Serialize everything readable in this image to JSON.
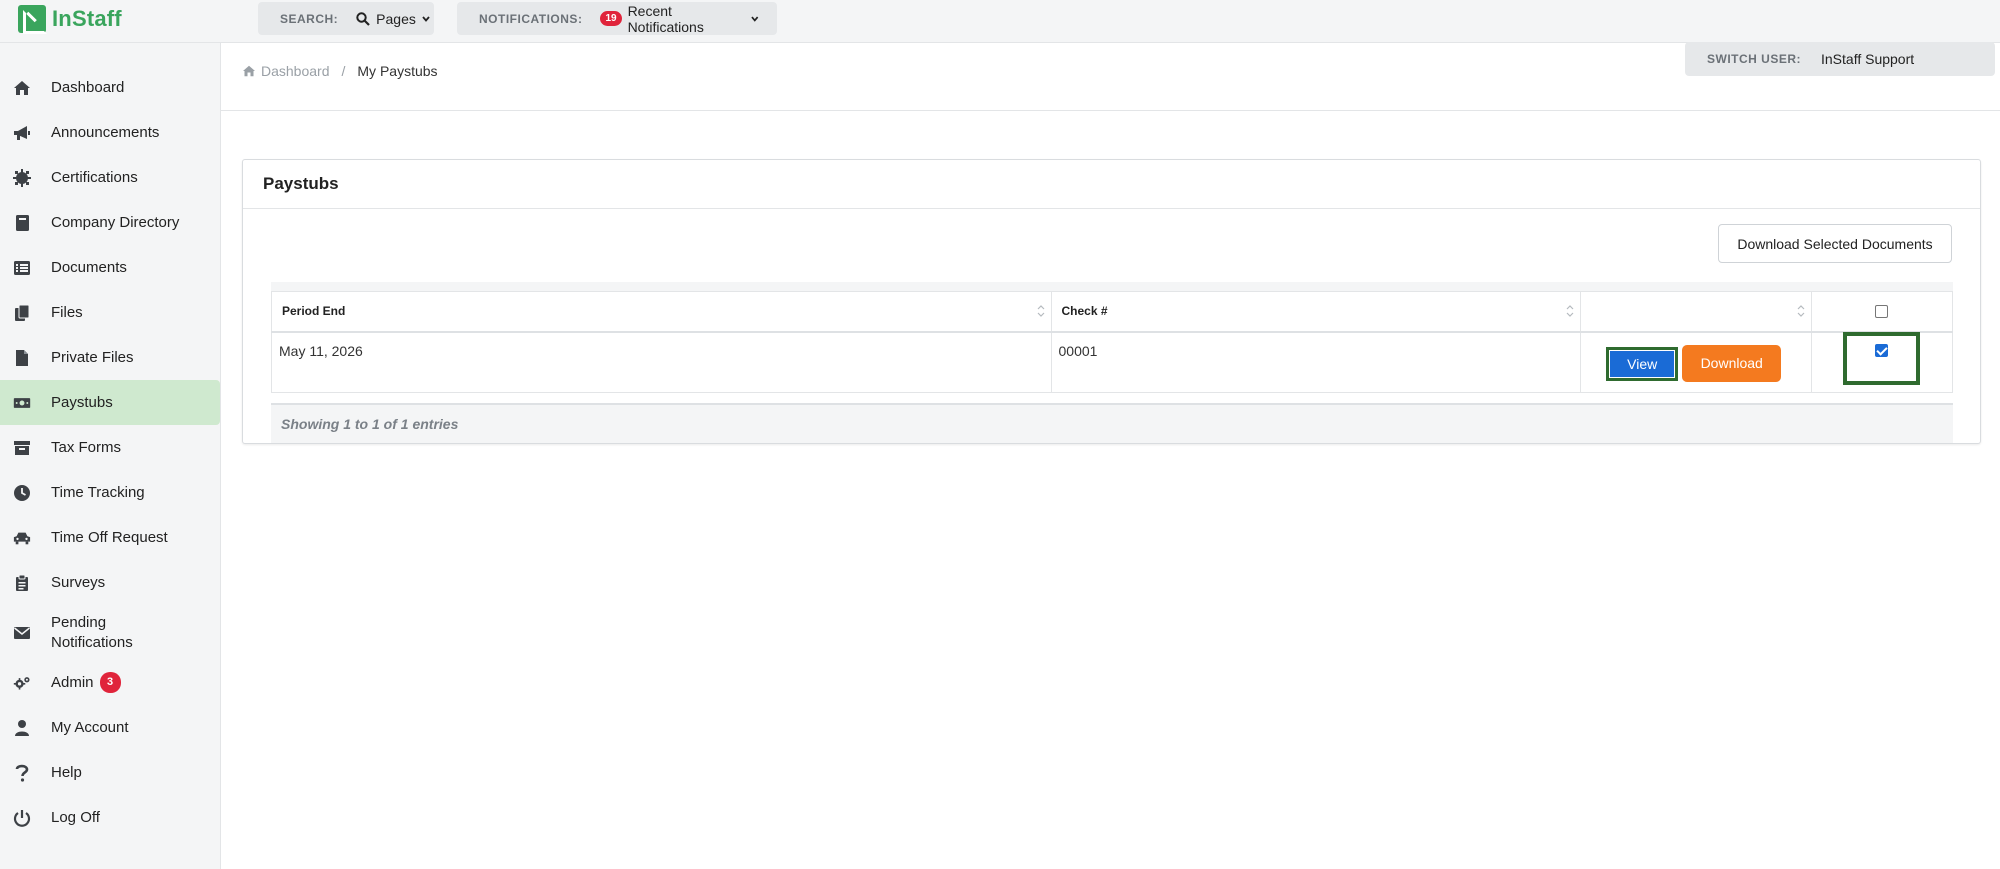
{
  "app": {
    "logo_text": "InStaff"
  },
  "topbar": {
    "search_label": "SEARCH:",
    "search_value": "Pages",
    "notifications_label": "NOTIFICATIONS:",
    "notifications_count": "19",
    "notifications_value": "Recent Notifications",
    "switch_user_label": "SWITCH USER:",
    "switch_user_value": "InStaff Support"
  },
  "sidebar": {
    "items": [
      {
        "label": "Dashboard",
        "icon": "home-icon"
      },
      {
        "label": "Announcements",
        "icon": "megaphone-icon"
      },
      {
        "label": "Certifications",
        "icon": "certificate-icon"
      },
      {
        "label": "Company Directory",
        "icon": "book-icon"
      },
      {
        "label": "Documents",
        "icon": "list-icon"
      },
      {
        "label": "Files",
        "icon": "files-icon"
      },
      {
        "label": "Private Files",
        "icon": "file-icon"
      },
      {
        "label": "Paystubs",
        "icon": "money-icon",
        "active": true
      },
      {
        "label": "Tax Forms",
        "icon": "archive-icon"
      },
      {
        "label": "Time Tracking",
        "icon": "clock-icon"
      },
      {
        "label": "Time Off Request",
        "icon": "car-icon"
      },
      {
        "label": "Surveys",
        "icon": "clipboard-icon"
      },
      {
        "label": "Pending Notifications",
        "icon": "envelope-icon"
      },
      {
        "label": "Admin",
        "icon": "gears-icon",
        "badge": "3"
      },
      {
        "label": "My Account",
        "icon": "user-icon"
      },
      {
        "label": "Help",
        "icon": "question-icon"
      },
      {
        "label": "Log Off",
        "icon": "power-icon"
      }
    ]
  },
  "breadcrumb": {
    "home": "Dashboard",
    "separator": "/",
    "current": "My Paystubs"
  },
  "card": {
    "title": "Paystubs",
    "download_selected_label": "Download Selected Documents",
    "table": {
      "columns": [
        "Period End",
        "Check #",
        "",
        ""
      ],
      "rows": [
        {
          "period_end": "May 11, 2026",
          "check_number": "00001",
          "view_label": "View",
          "download_label": "Download",
          "selected": true
        }
      ]
    },
    "footer_info": "Showing 1 to 1 of 1 entries"
  },
  "colors": {
    "brand_green": "#3aa55d",
    "active_nav": "#cfe9cf",
    "view_button": "#1a6bd6",
    "download_button": "#f47a1f",
    "badge_red": "#e0243b",
    "highlight_outline": "#2f6b2f"
  }
}
